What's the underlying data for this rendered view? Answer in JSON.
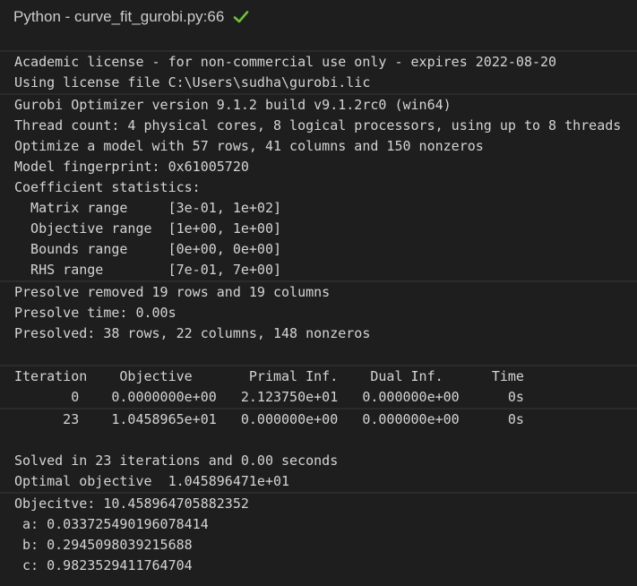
{
  "header": {
    "title": "Python - curve_fit_gurobi.py:66",
    "status_icon": "checkmark-icon",
    "status_color": "#6fbf40"
  },
  "cells": [
    {
      "lines": [
        "Academic license - for non-commercial use only - expires 2022-08-20",
        "Using license file C:\\Users\\sudha\\gurobi.lic"
      ]
    },
    {
      "lines": [
        "Gurobi Optimizer version 9.1.2 build v9.1.2rc0 (win64)",
        "Thread count: 4 physical cores, 8 logical processors, using up to 8 threads",
        "Optimize a model with 57 rows, 41 columns and 150 nonzeros",
        "Model fingerprint: 0x61005720",
        "Coefficient statistics:",
        "  Matrix range     [3e-01, 1e+02]",
        "  Objective range  [1e+00, 1e+00]",
        "  Bounds range     [0e+00, 0e+00]",
        "  RHS range        [7e-01, 7e+00]"
      ]
    },
    {
      "lines": [
        "Presolve removed 19 rows and 19 columns",
        "Presolve time: 0.00s",
        "Presolved: 38 rows, 22 columns, 148 nonzeros",
        ""
      ]
    },
    {
      "lines": [
        "Iteration    Objective       Primal Inf.    Dual Inf.      Time",
        "       0    0.0000000e+00   2.123750e+01   0.000000e+00      0s"
      ]
    },
    {
      "lines": [
        "      23    1.0458965e+01   0.000000e+00   0.000000e+00      0s",
        "",
        "Solved in 23 iterations and 0.00 seconds",
        "Optimal objective  1.045896471e+01"
      ]
    },
    {
      "lines": [
        "Objecitve: 10.458964705882352",
        " a: 0.033725490196078414",
        " b: 0.2945098039215688",
        " c: 0.9823529411764704"
      ]
    }
  ]
}
